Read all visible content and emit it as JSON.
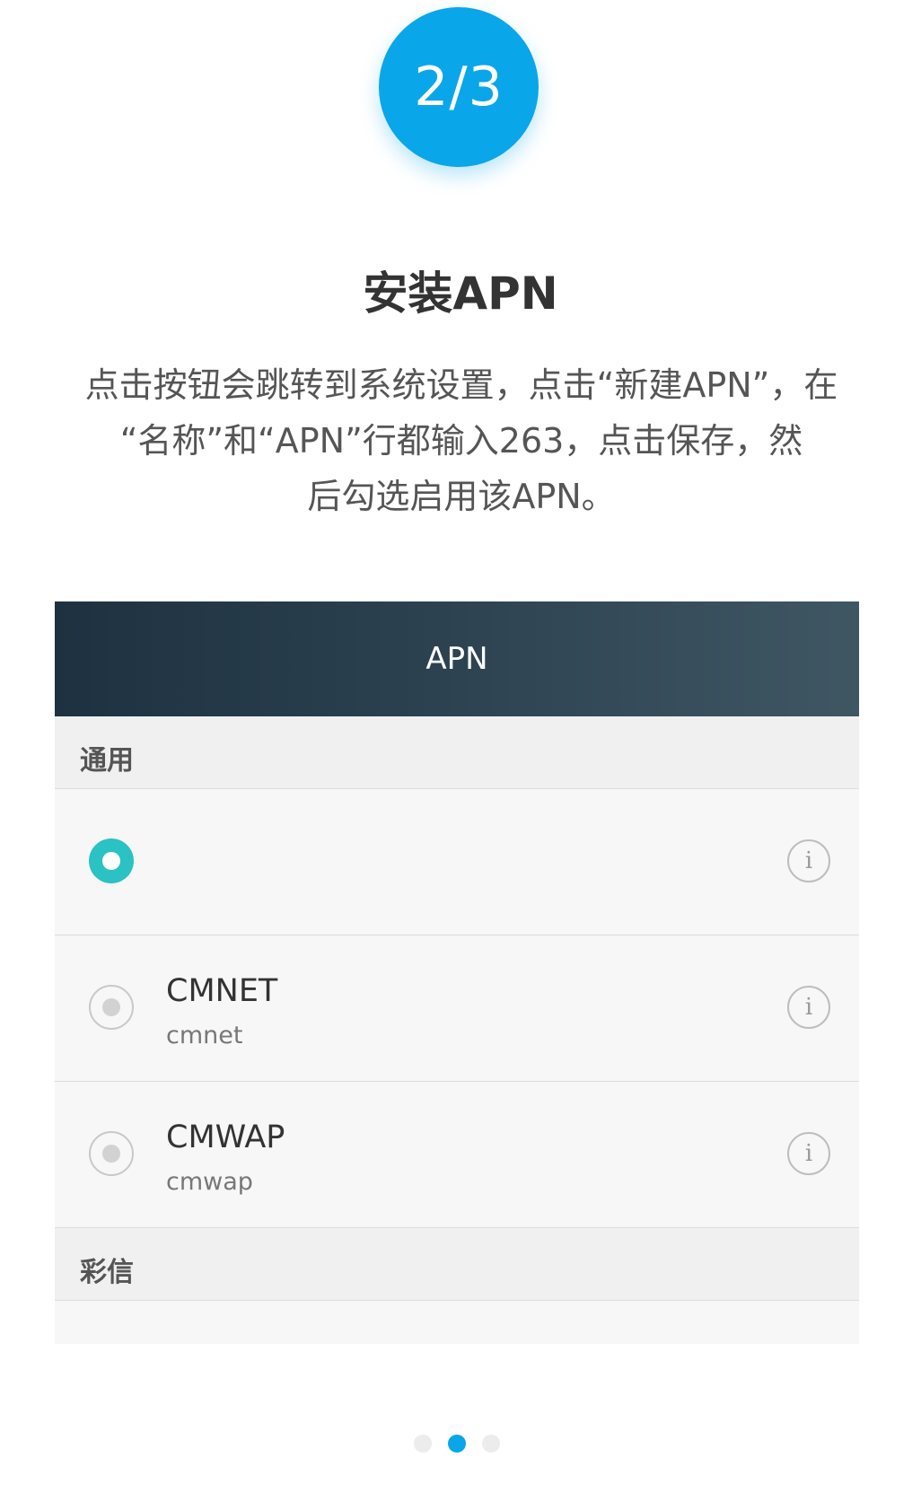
{
  "step_badge": {
    "text": "2/3",
    "color": "#0aa6ea"
  },
  "title": "安装APN",
  "description": {
    "lines": [
      "点击按钮会跳转到系统设置，点击“新建APN”，在",
      "“名称”和“APN”行都输入263，点击保存，然",
      "后勾选启用该APN。"
    ]
  },
  "apn_screen": {
    "header_title": "APN",
    "section_general": "通用",
    "items": [
      {
        "name": "",
        "subtitle": "",
        "selected": true,
        "icon": "info-icon"
      },
      {
        "name": "CMNET",
        "subtitle": "cmnet",
        "selected": false,
        "icon": "info-icon"
      },
      {
        "name": "CMWAP",
        "subtitle": "cmwap",
        "selected": false,
        "icon": "info-icon"
      }
    ],
    "section_mms": "彩信",
    "radio_selected_color": "#2bc2c3"
  },
  "pager": {
    "total": 3,
    "current": 2,
    "active_color": "#0aa6ea"
  }
}
